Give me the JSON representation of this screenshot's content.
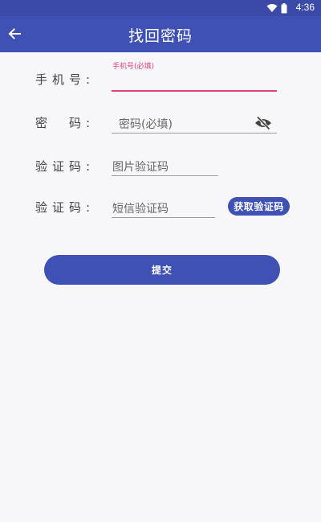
{
  "status_bar": {
    "time": "4:36",
    "icons": [
      "wifi-icon",
      "battery-icon"
    ]
  },
  "app_bar": {
    "title": "找回密码",
    "back_icon": "arrow-left-icon"
  },
  "form": {
    "phone": {
      "label": "手机号:",
      "floating_label": "手机号(必填)",
      "value": ""
    },
    "password": {
      "label": "密　码:",
      "placeholder": "密码(必填)",
      "visibility_icon": "eye-off-icon"
    },
    "image_code": {
      "label": "验证码:",
      "placeholder": "图片验证码"
    },
    "sms_code": {
      "label": "验证码:",
      "placeholder": "短信验证码",
      "button_label": "获取验证码"
    },
    "submit_label": "提交"
  },
  "colors": {
    "primary": "#3f51b5",
    "status_bar": "#3a4aa6",
    "accent": "#e4407a",
    "background": "#f7f7f9"
  }
}
